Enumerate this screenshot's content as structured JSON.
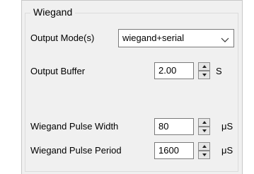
{
  "group": {
    "title": "Wiegand"
  },
  "output_mode": {
    "label": "Output Mode(s)",
    "selected": "wiegand+serial"
  },
  "output_buffer": {
    "label": "Output Buffer",
    "value": "2.00",
    "unit": "S"
  },
  "pulse_width": {
    "label": "Wiegand Pulse Width",
    "value": "80",
    "unit": "μS"
  },
  "pulse_period": {
    "label": "Wiegand Pulse Period",
    "value": "1600",
    "unit": "μS"
  },
  "icons": {
    "combo_arrow": "chevron-down-icon",
    "spin_up": "caret-up-icon",
    "spin_down": "caret-down-icon"
  }
}
